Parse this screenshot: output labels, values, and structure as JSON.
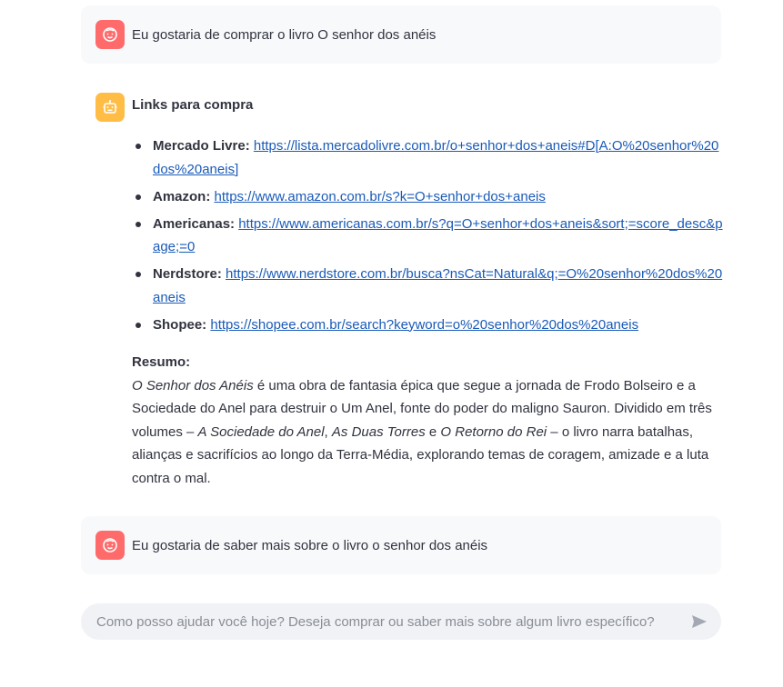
{
  "messages": {
    "user1": {
      "text": "Eu gostaria de comprar o livro O senhor dos anéis",
      "avatar_icon": "face-icon"
    },
    "bot": {
      "avatar_icon": "robot-icon",
      "title": "Links para compra",
      "links": [
        {
          "store": "Mercado Livre:",
          "url": "https://lista.mercadolivre.com.br/o+senhor+dos+aneis#D[A:O%20senhor%20dos%20aneis]"
        },
        {
          "store": "Amazon:",
          "url": "https://www.amazon.com.br/s?k=O+senhor+dos+aneis"
        },
        {
          "store": "Americanas:",
          "url": "https://www.americanas.com.br/s?q=O+senhor+dos+aneis&sort;=score_desc&page;=0"
        },
        {
          "store": "Nerdstore:",
          "url": "https://www.nerdstore.com.br/busca?nsCat=Natural&q;=O%20senhor%20dos%20aneis"
        },
        {
          "store": "Shopee:",
          "url": "https://shopee.com.br/search?keyword=o%20senhor%20dos%20aneis"
        }
      ],
      "summary_label": "Resumo:",
      "summary": {
        "p1_italic": "O Senhor dos Anéis",
        "p2": " é uma obra de fantasia épica que segue a jornada de Frodo Bolseiro e a Sociedade do Anel para destruir o Um Anel, fonte do poder do maligno Sauron. Dividido em três volumes – ",
        "vol1": "A Sociedade do Anel",
        "sep1": ", ",
        "vol2": "As Duas Torres",
        "sep2": " e ",
        "vol3": "O Retorno do Rei",
        "p3": " – o livro narra batalhas, alianças e sacrifícios ao longo da Terra-Média, explorando temas de coragem, amizade e a luta contra o mal."
      }
    },
    "user2": {
      "text": "Eu gostaria de saber mais sobre o livro o senhor dos anéis",
      "avatar_icon": "face-icon"
    }
  },
  "chat_input": {
    "placeholder": "Como posso ajudar você hoje? Deseja comprar ou saber mais sobre algum livro específico?",
    "value": "",
    "send_icon": "send-icon"
  },
  "colors": {
    "user_avatar": "#ff6b6b",
    "bot_avatar": "#ffbd45",
    "link": "#1a5bb8",
    "message_bg": "#f8f9fb",
    "input_bg": "#f0f2f6"
  }
}
